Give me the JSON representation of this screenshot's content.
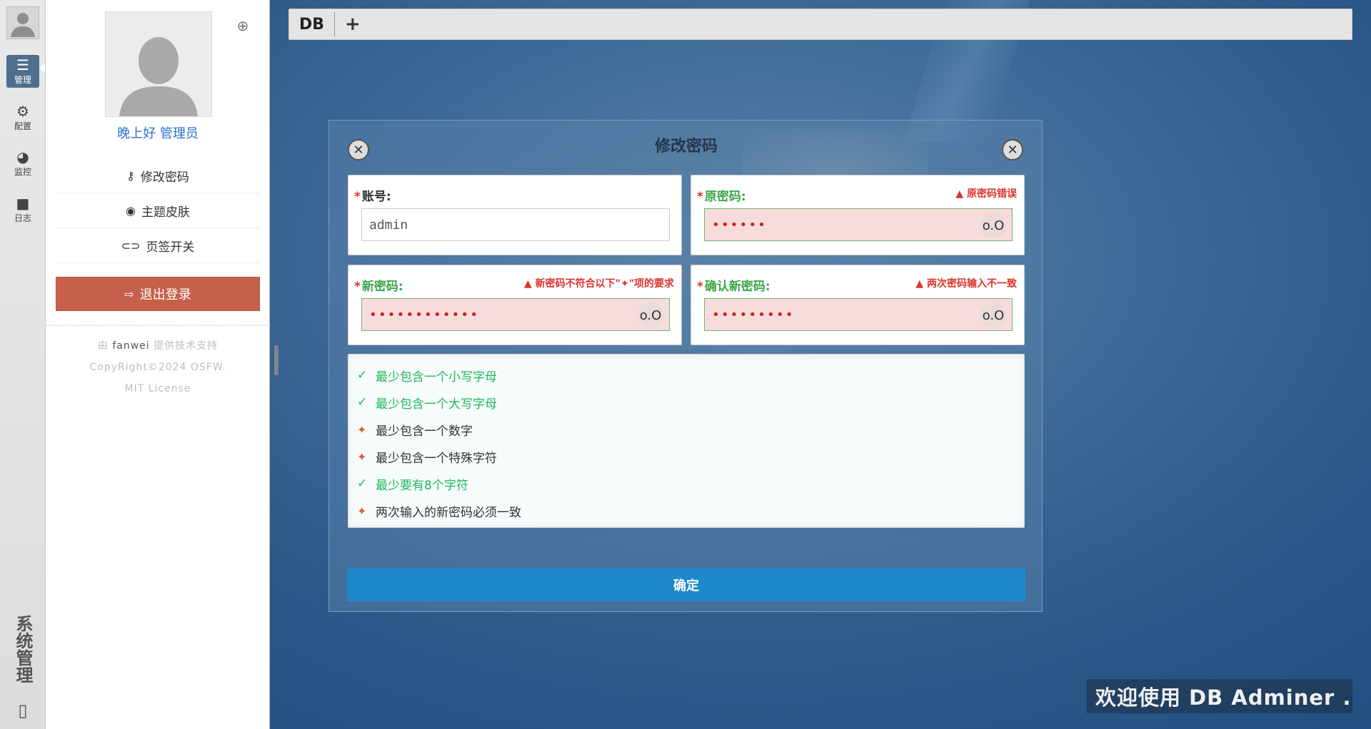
{
  "rail": {
    "items": [
      {
        "label": "管理",
        "icon": "sliders-icon",
        "glyph": "☰"
      },
      {
        "label": "配置",
        "icon": "gears-icon",
        "glyph": "⚙"
      },
      {
        "label": "监控",
        "icon": "dashboard-icon",
        "glyph": "◕"
      },
      {
        "label": "日志",
        "icon": "video-camera-icon",
        "glyph": "■"
      }
    ],
    "vertical_title": "系统管理",
    "bottom_glyph": "▯"
  },
  "panel": {
    "greeting": "晚上好 管理员",
    "menu": [
      {
        "label": "修改密码",
        "icon": "key-icon",
        "glyph": "🔑"
      },
      {
        "label": "主题皮肤",
        "icon": "palette-icon",
        "glyph": "◉"
      },
      {
        "label": "页签开关",
        "icon": "toggle-icon",
        "glyph": "⊂⊃"
      }
    ],
    "logout_label": "退出登录",
    "credits": {
      "line1_prefix": "由",
      "line1_name": "fanwei",
      "line1_suffix": "提供技术支持",
      "line2": "CopyRight©2024 OSFW.",
      "line3": "MIT License"
    }
  },
  "tabs": {
    "items": [
      "DB"
    ],
    "add_glyph": "+"
  },
  "dialog": {
    "title": "修改密码",
    "close_glyph": "✕",
    "account": {
      "label": "账号:",
      "value": "admin"
    },
    "old_password": {
      "label": "原密码:",
      "error": "原密码错误",
      "value": "••••••",
      "toggle": "o.O"
    },
    "new_password": {
      "label": "新密码:",
      "error": "新密码不符合以下\"✦\"项的要求",
      "value": "••••••••••••",
      "toggle": "o.O"
    },
    "confirm_password": {
      "label": "确认新密码:",
      "error": "两次密码输入不一致",
      "value": "•••••••••",
      "toggle": "o.O"
    },
    "warn_glyph": "▲",
    "required_mark": "*",
    "rules": [
      {
        "text": "最少包含一个小写字母",
        "status": "ok",
        "mark": "✓"
      },
      {
        "text": "最少包含一个大写字母",
        "status": "ok",
        "mark": "✓"
      },
      {
        "text": "最少包含一个数字",
        "status": "pending",
        "mark": "✦"
      },
      {
        "text": "最少包含一个特殊字符",
        "status": "pending",
        "mark": "✦"
      },
      {
        "text": "最少要有8个字符",
        "status": "ok",
        "mark": "✓"
      },
      {
        "text": "两次输入的新密码必须一致",
        "status": "pending",
        "mark": "✦"
      }
    ],
    "confirm_label": "确定"
  },
  "welcome": "欢迎使用 DB Adminer .",
  "colors": {
    "accent_blue": "#1f8acb",
    "logout_red": "#c6604a",
    "error_red": "#d9332b",
    "ok_green": "#22b85a",
    "pending_orange": "#d9602b"
  }
}
